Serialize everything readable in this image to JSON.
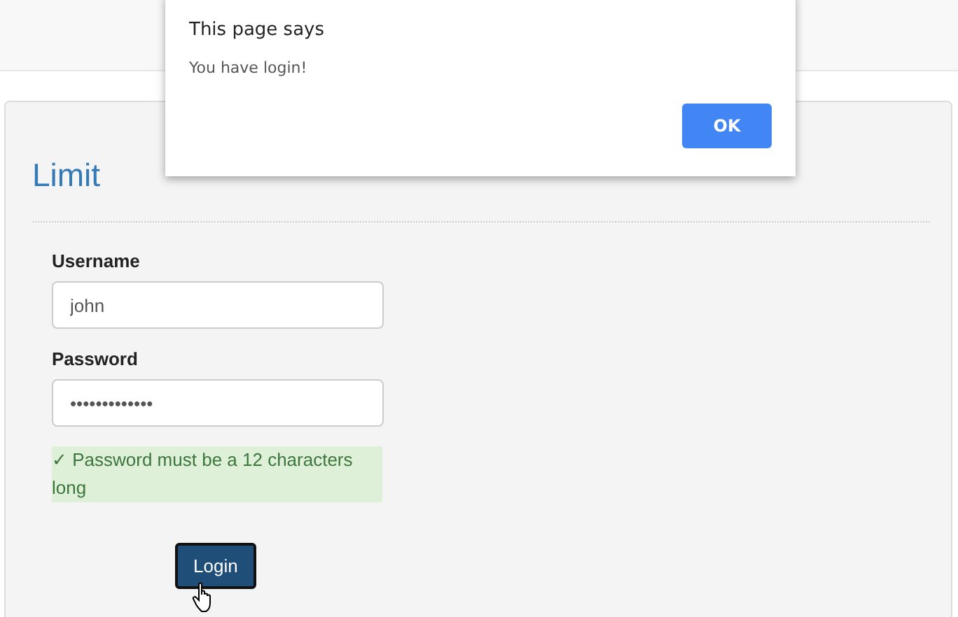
{
  "panel": {
    "title": "Limit",
    "fields": [
      {
        "label": "Username",
        "value": "john"
      },
      {
        "label": "Password",
        "value": "•••••••••••••"
      }
    ],
    "message": {
      "text": "✓ Password must be a 12 characters long",
      "valid": true
    },
    "button": "Login"
  },
  "dialog": {
    "title": "This page says",
    "message": "You have login!",
    "button": "OK"
  }
}
